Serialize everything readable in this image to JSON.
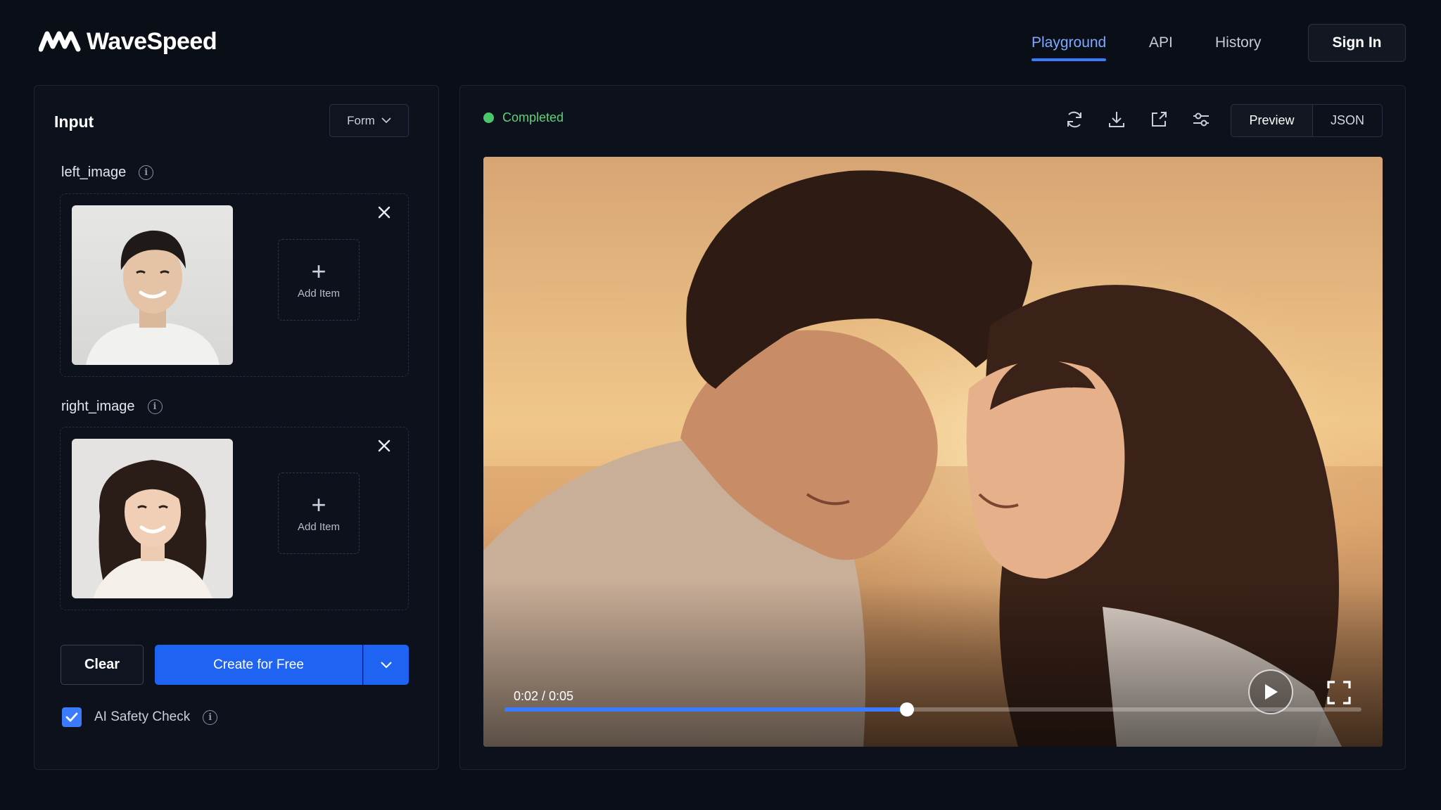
{
  "brand": {
    "name": "WaveSpeed"
  },
  "nav": {
    "items": [
      {
        "label": "Playground",
        "active": true
      },
      {
        "label": "API",
        "active": false
      },
      {
        "label": "History",
        "active": false
      }
    ],
    "sign_in": "Sign In"
  },
  "input_panel": {
    "title": "Input",
    "mode_select": "Form",
    "fields": [
      {
        "label": "left_image",
        "add_label": "Add Item"
      },
      {
        "label": "right_image",
        "add_label": "Add Item"
      }
    ],
    "clear_label": "Clear",
    "create_label": "Create for Free",
    "safety_label": "AI Safety Check",
    "safety_checked": true
  },
  "output_panel": {
    "status": "Completed",
    "status_color": "#4cc66a",
    "tools": [
      "refresh-icon",
      "download-icon",
      "external-link-icon",
      "sliders-icon"
    ],
    "view_toggle": {
      "preview": "Preview",
      "json": "JSON",
      "active": "preview"
    },
    "player": {
      "time": "0:02 / 0:05",
      "progress": 0.47
    }
  },
  "colors": {
    "accent": "#1e63f2",
    "active_nav": "#7fa8ff",
    "background": "#0a0e17"
  }
}
